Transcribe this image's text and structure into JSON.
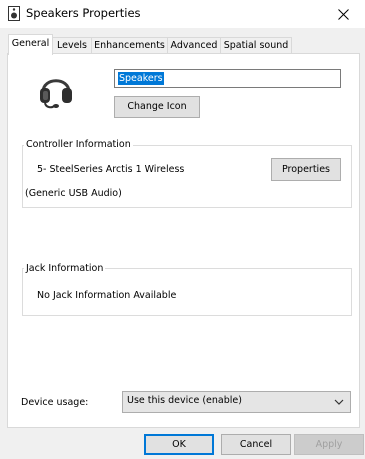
{
  "window": {
    "title": "Speakers Properties",
    "close_glyph": "✕"
  },
  "tabs": [
    {
      "label": "General",
      "active": true
    },
    {
      "label": "Levels"
    },
    {
      "label": "Enhancements"
    },
    {
      "label": "Advanced"
    },
    {
      "label": "Spatial sound"
    }
  ],
  "general": {
    "device_name": "Speakers",
    "change_icon_label": "Change Icon",
    "controller": {
      "legend": "Controller Information",
      "name": "5- SteelSeries Arctis 1 Wireless",
      "driver": "(Generic USB Audio)",
      "properties_label": "Properties"
    },
    "jack": {
      "legend": "Jack Information",
      "text": "No Jack Information Available"
    },
    "device_usage": {
      "label": "Device usage:",
      "value": "Use this device (enable)"
    }
  },
  "footer": {
    "ok_label": "OK",
    "cancel_label": "Cancel",
    "apply_label": "Apply"
  },
  "colors": {
    "selection": "#0078d7",
    "ok_border": "#0078d7"
  },
  "icons": {
    "title": "speaker-icon",
    "device": "headset-icon",
    "close": "close-icon",
    "dropdown": "chevron-down-icon"
  }
}
